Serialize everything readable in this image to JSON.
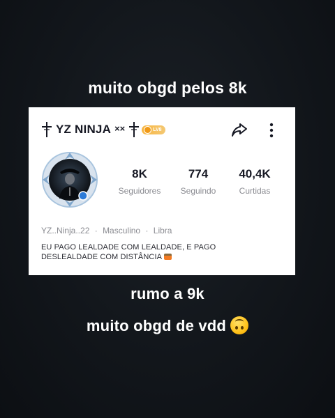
{
  "captions": {
    "top": "muito obgd pelos 8k",
    "middle": "rumo a 9k",
    "bottom": "muito obgd de vdd"
  },
  "profile": {
    "username": "YZ NINJA",
    "name_decoration": "××",
    "level_badge": "LV8",
    "stats": [
      {
        "value": "8K",
        "label": "Seguidores"
      },
      {
        "value": "774",
        "label": "Seguindo"
      },
      {
        "value": "40,4K",
        "label": "Curtidas"
      }
    ],
    "meta": {
      "handle": "YZ..Ninja..22",
      "gender": "Masculino",
      "sign": "Libra",
      "separator": "·"
    },
    "bio": {
      "line1": "EU PAGO LEALDADE COM LEALDADE, E PAGO",
      "line2": "DESLEALDADE COM DISTÂNCIA"
    }
  },
  "icons": {
    "share": "share-arrow-icon",
    "more": "more-vertical-icon",
    "cross": "cross-symbol-icon",
    "emoji": "upside-down-face-emoji"
  },
  "colors": {
    "background": "#12161b",
    "card": "#ffffff",
    "text_primary": "#161823",
    "text_secondary": "#8a8b91",
    "badge": "#f8b640"
  }
}
